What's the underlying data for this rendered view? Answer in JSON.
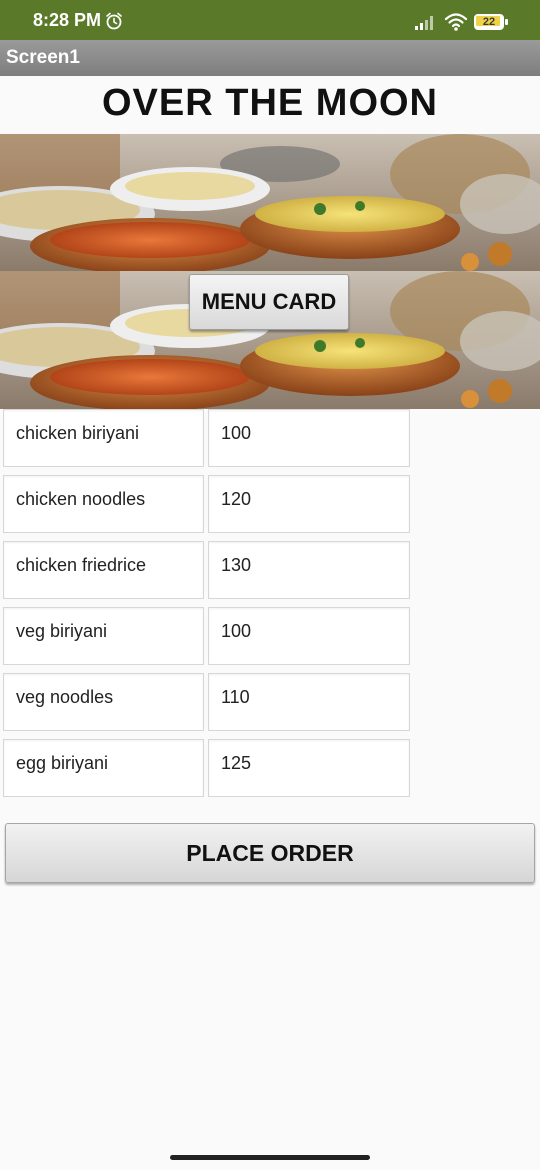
{
  "status_bar": {
    "time": "8:28 PM",
    "battery": "22",
    "icons": [
      "alarm-icon",
      "signal-icon",
      "wifi-icon",
      "battery-icon"
    ]
  },
  "title_bar": {
    "title": "Screen1"
  },
  "heading": "OVER THE MOON",
  "menu_card_button": "MENU CARD",
  "menu_items": [
    {
      "name": "chicken biriyani",
      "price": "100"
    },
    {
      "name": "chicken noodles",
      "price": "120"
    },
    {
      "name": "chicken friedrice",
      "price": "130"
    },
    {
      "name": "veg biriyani",
      "price": "100"
    },
    {
      "name": "veg noodles",
      "price": "110"
    },
    {
      "name": "egg biriyani",
      "price": "125"
    }
  ],
  "place_order_button": "PLACE ORDER",
  "colors": {
    "status_bar": "#5a7a2a",
    "title_bar": "#8a8a8a",
    "background": "#fafafa"
  }
}
